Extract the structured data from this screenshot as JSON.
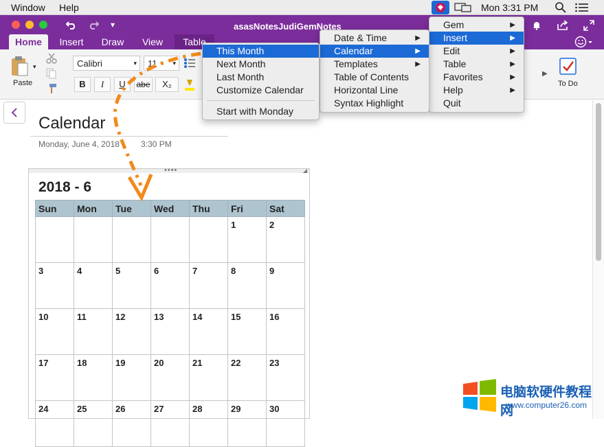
{
  "menubar": {
    "window": "Window",
    "help": "Help",
    "clock": "Mon 3:31 PM"
  },
  "titlebar": {
    "title": "asasNotesJudiGemNotes"
  },
  "tabs": [
    "Home",
    "Insert",
    "Draw",
    "View",
    "Table"
  ],
  "ribbon": {
    "paste": "Paste",
    "font": "Calibri",
    "size": "11",
    "bold": "B",
    "italic": "I",
    "underline": "U",
    "strike": "abe",
    "sub": "X₂",
    "todo": "To Do"
  },
  "page": {
    "title": "Calendar",
    "date": "Monday, June 4, 2018",
    "time": "3:30 PM"
  },
  "calendar": {
    "heading": "2018 - 6",
    "days": [
      "Sun",
      "Mon",
      "Tue",
      "Wed",
      "Thu",
      "Fri",
      "Sat"
    ],
    "weeks": [
      [
        "",
        "",
        "",
        "",
        "",
        "1",
        "2"
      ],
      [
        "3",
        "4",
        "5",
        "6",
        "7",
        "8",
        "9"
      ],
      [
        "10",
        "11",
        "12",
        "13",
        "14",
        "15",
        "16"
      ],
      [
        "17",
        "18",
        "19",
        "20",
        "21",
        "22",
        "23"
      ],
      [
        "24",
        "25",
        "26",
        "27",
        "28",
        "29",
        "30"
      ]
    ]
  },
  "menu_gem": {
    "items": [
      "Gem",
      "Insert",
      "Edit",
      "Table",
      "Favorites",
      "Help",
      "Quit"
    ],
    "selected": 1
  },
  "menu_insert": {
    "items": [
      "Date & Time",
      "Calendar",
      "Templates",
      "Table of Contents",
      "Horizontal Line",
      "Syntax Highlight"
    ],
    "selected": 1
  },
  "menu_calendar": {
    "items": [
      "This Month",
      "Next Month",
      "Last Month",
      "Customize Calendar",
      "Start with Monday"
    ],
    "selected": 0
  },
  "watermark": {
    "cn": "电脑软硬件教程网",
    "url": "www.computer26.com"
  },
  "colors": {
    "purple": "#7b2d9b",
    "selected": "#1c6ad6",
    "arrow": "#f08a1a",
    "header": "#aec4cf"
  }
}
